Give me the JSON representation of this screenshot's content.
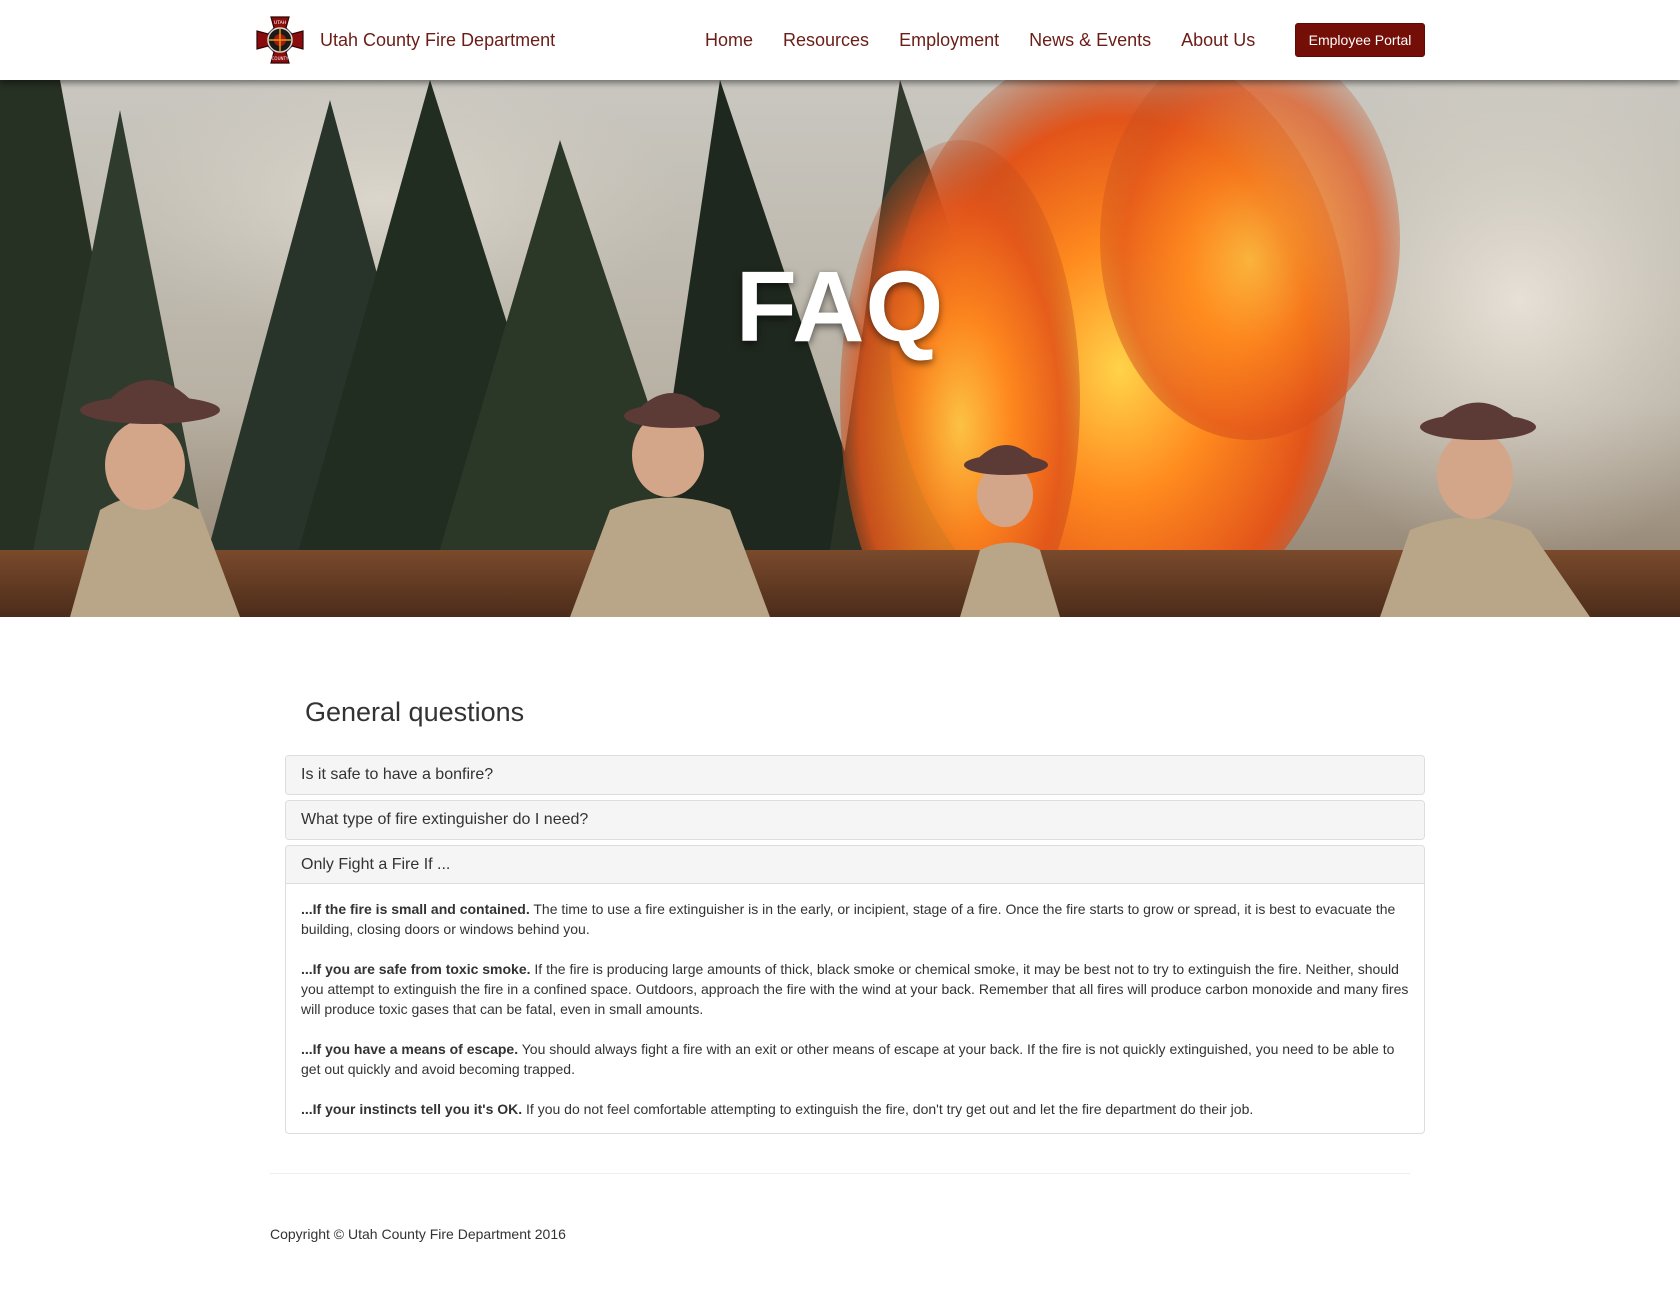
{
  "brand": {
    "name": "Utah County Fire Department",
    "logo_top_text": "UTAH",
    "logo_bottom_text": "COUNTY",
    "logo_letters": "UCFD"
  },
  "nav": {
    "items": [
      {
        "label": "Home"
      },
      {
        "label": "Resources"
      },
      {
        "label": "Employment"
      },
      {
        "label": "News & Events"
      },
      {
        "label": "About Us"
      }
    ],
    "portal_label": "Employee Portal"
  },
  "hero": {
    "title": "FAQ"
  },
  "faq": {
    "section_title": "General questions",
    "items": [
      {
        "question": "Is it safe to have a bonfire?"
      },
      {
        "question": "What type of fire extinguisher do I need?"
      },
      {
        "question": "Only Fight a Fire If ..."
      }
    ],
    "open_answer": [
      {
        "lead": "...If the fire is small and contained.",
        "text": "The time to use a fire extinguisher is in the early, or incipient, stage of a fire. Once the fire starts to grow or spread, it is best to evacuate the building, closing doors or windows behind you."
      },
      {
        "lead": "...If you are safe from toxic smoke.",
        "text": "If the fire is producing large amounts of thick, black smoke or chemical smoke, it may be best not to try to extinguish the fire. Neither, should you attempt to extinguish the fire in a confined space. Outdoors, approach the fire with the wind at your back. Remember that all fires will produce carbon monoxide and many fires will produce toxic gases that can be fatal, even in small amounts."
      },
      {
        "lead": "...If you have a means of escape.",
        "text": "You should always fight a fire with an exit or other means of escape at your back. If the fire is not quickly extinguished, you need to be able to get out quickly and avoid becoming trapped."
      },
      {
        "lead": "...If your instincts tell you it's OK.",
        "text": "If you do not feel comfortable attempting to extinguish the fire, don't try get out and let the fire department do their job."
      }
    ]
  },
  "footer": {
    "copyright": "Copyright © Utah County Fire Department 2016"
  },
  "colors": {
    "brand_maroon": "#6b1d17",
    "portal_button": "#730f06",
    "panel_heading_bg": "#f5f5f5",
    "panel_border": "#dddddd"
  }
}
